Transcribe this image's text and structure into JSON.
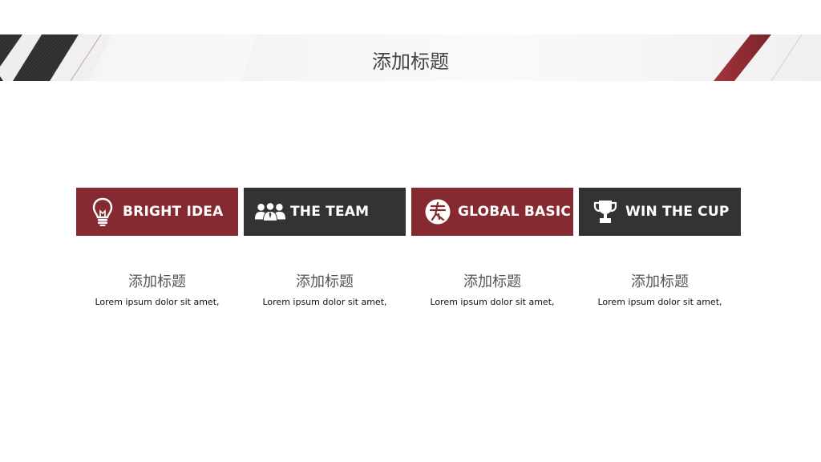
{
  "header": {
    "title": "添加标题"
  },
  "cards": [
    {
      "label": "BRIGHT IDEA",
      "icon": "lightbulb-icon",
      "color": "#862a32"
    },
    {
      "label": "THE TEAM",
      "icon": "team-icon",
      "color": "#333333"
    },
    {
      "label": "GLOBAL BASIC",
      "icon": "globe-icon",
      "color": "#862a32"
    },
    {
      "label": "WIN THE CUP",
      "icon": "trophy-icon",
      "color": "#333333"
    }
  ],
  "columns": [
    {
      "title": "添加标题",
      "desc": "Lorem ipsum dolor sit amet,"
    },
    {
      "title": "添加标题",
      "desc": "Lorem ipsum dolor sit amet,"
    },
    {
      "title": "添加标题",
      "desc": "Lorem ipsum dolor sit amet,"
    },
    {
      "title": "添加标题",
      "desc": "Lorem ipsum dolor sit amet,"
    }
  ],
  "colors": {
    "accent_red": "#862a32",
    "dark": "#333333"
  }
}
